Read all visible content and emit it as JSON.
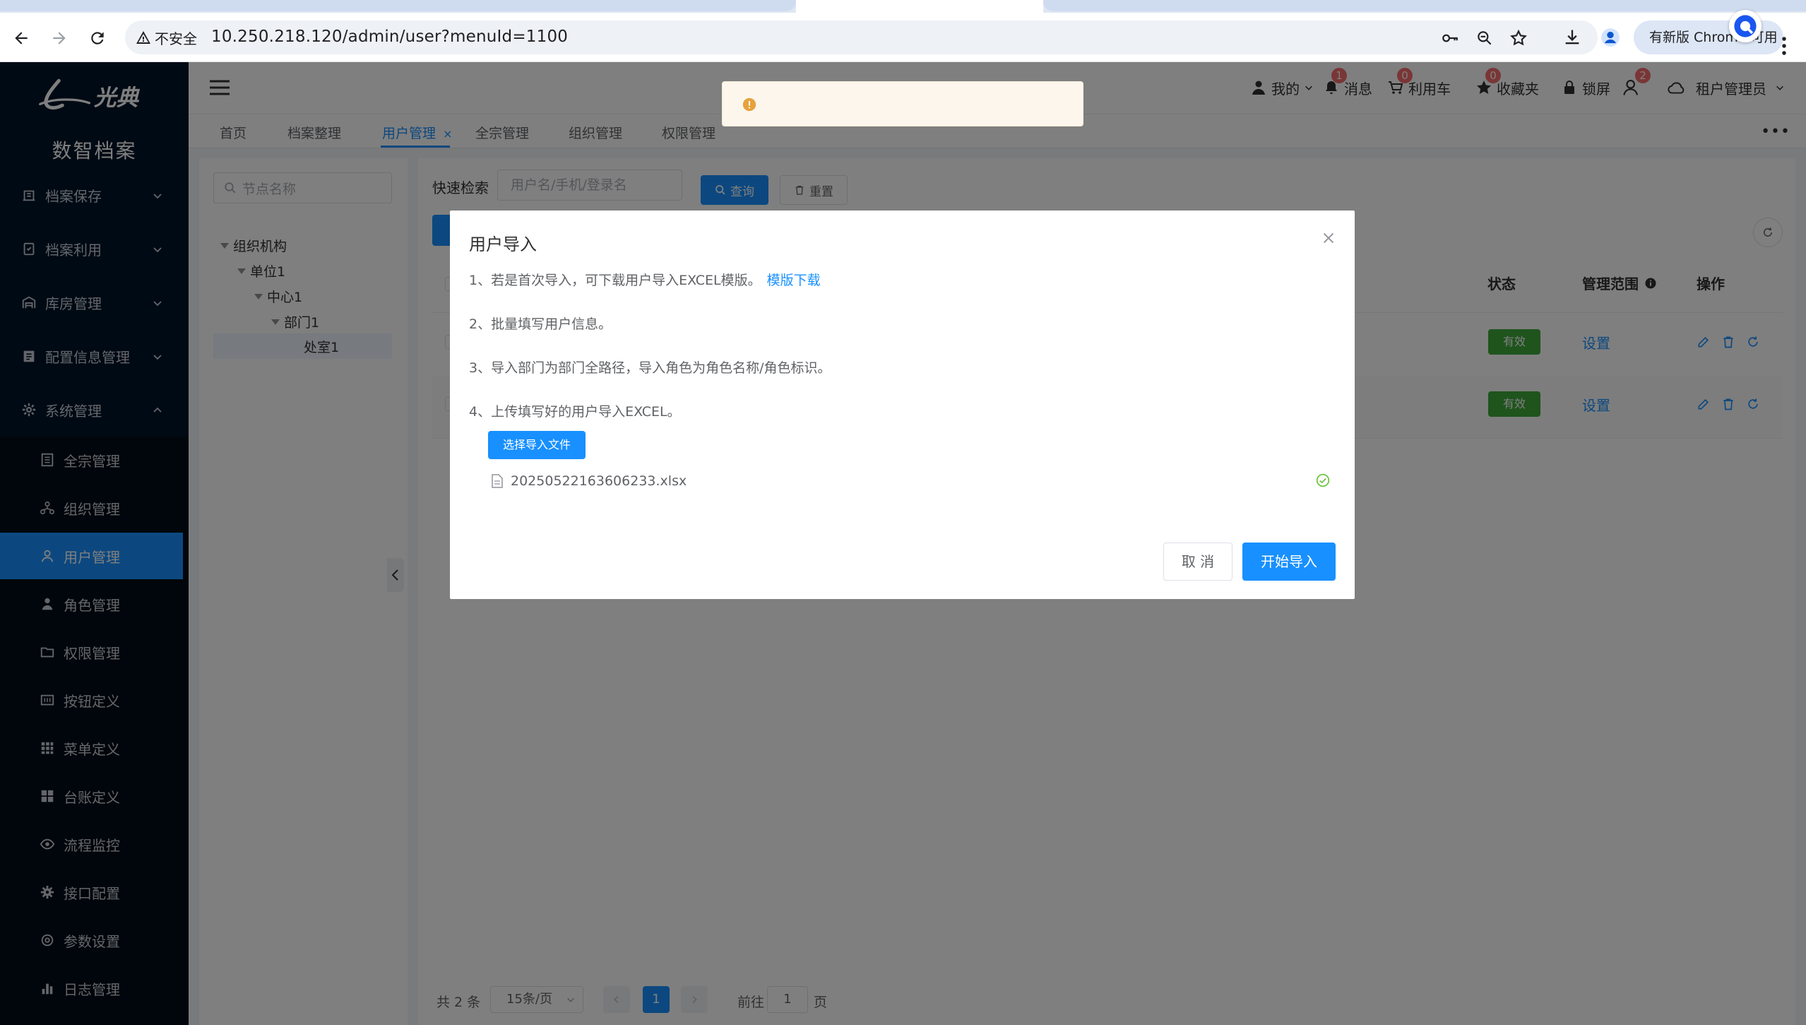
{
  "browser": {
    "security_label": "不安全",
    "url": "10.250.218.120/admin/user?menuId=1100",
    "update_label": "有新版 Chrome 可用"
  },
  "app": {
    "title": "数智档案",
    "logo_text": "光典"
  },
  "sidebar": {
    "groups": [
      {
        "label": "档案保存",
        "icon": "archive-save-icon"
      },
      {
        "label": "档案利用",
        "icon": "clipboard-icon"
      },
      {
        "label": "库房管理",
        "icon": "warehouse-icon"
      },
      {
        "label": "配置信息管理",
        "icon": "config-icon"
      },
      {
        "label": "系统管理",
        "icon": "gear-icon",
        "expanded": true
      }
    ],
    "items": [
      {
        "label": "全宗管理",
        "icon": "document-icon"
      },
      {
        "label": "组织管理",
        "icon": "org-tree-icon"
      },
      {
        "label": "用户管理",
        "icon": "user-icon",
        "active": true
      },
      {
        "label": "角色管理",
        "icon": "person-icon"
      },
      {
        "label": "权限管理",
        "icon": "folder-icon"
      },
      {
        "label": "按钮定义",
        "icon": "button-icon"
      },
      {
        "label": "菜单定义",
        "icon": "grid-icon"
      },
      {
        "label": "台账定义",
        "icon": "apps-icon"
      },
      {
        "label": "流程监控",
        "icon": "eye-icon"
      },
      {
        "label": "接口配置",
        "icon": "cog-icon"
      },
      {
        "label": "参数设置",
        "icon": "settings-icon"
      },
      {
        "label": "日志管理",
        "icon": "bar-chart-icon"
      }
    ]
  },
  "header": {
    "mine": "我的",
    "messages": "消息",
    "messages_badge": "1",
    "cart": "利用车",
    "cart_badge": "0",
    "favorites": "收藏夹",
    "favorites_badge": "0",
    "lock": "锁屏",
    "users_badge": "2",
    "tenant": "租户管理员"
  },
  "tabs": [
    {
      "label": "首页"
    },
    {
      "label": "档案整理"
    },
    {
      "label": "用户管理",
      "active": true
    },
    {
      "label": "全宗管理"
    },
    {
      "label": "组织管理"
    },
    {
      "label": "权限管理"
    }
  ],
  "tree": {
    "search_placeholder": "节点名称",
    "nodes": [
      {
        "label": "组织机构",
        "depth": 0
      },
      {
        "label": "单位1",
        "depth": 1
      },
      {
        "label": "中心1",
        "depth": 2
      },
      {
        "label": "部门1",
        "depth": 3
      },
      {
        "label": "处室1",
        "depth": 4,
        "selected": true
      }
    ]
  },
  "search": {
    "label": "快速检索",
    "placeholder": "用户名/手机/登录名",
    "query_button": "查询",
    "reset_button": "重置"
  },
  "table": {
    "columns": [
      "状态",
      "管理范围",
      "操作"
    ],
    "rows": [
      {
        "status": "有效",
        "scope": "设置"
      },
      {
        "status": "有效",
        "scope": "设置"
      }
    ]
  },
  "pagination": {
    "total": "共 2 条",
    "page_size": "15条/页",
    "current_page": "1",
    "goto_label": "前往",
    "goto_value": "1",
    "page_suffix": "页"
  },
  "dialog": {
    "title": "用户导入",
    "step1": "1、若是首次导入，可下载用户导入EXCEL模版。",
    "template_link": "模版下载",
    "step2": "2、批量填写用户信息。",
    "step3": "3、导入部门为部门全路径，导入角色为角色名称/角色标识。",
    "step4": "4、上传填写好的用户导入EXCEL。",
    "upload_button": "选择导入文件",
    "file_name": "20250522163606233.xlsx",
    "cancel_button": "取 消",
    "start_button": "开始导入"
  },
  "colors": {
    "primary": "#1890ff",
    "sidebar_bg": "#001529",
    "success": "#3ea83a",
    "warning": "#e6a23c"
  }
}
